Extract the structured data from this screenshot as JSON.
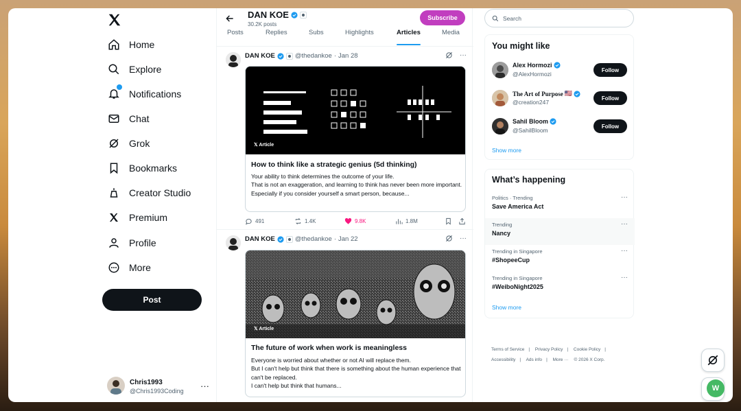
{
  "nav": {
    "items": [
      {
        "label": "Home",
        "icon": "home-icon"
      },
      {
        "label": "Explore",
        "icon": "search-icon"
      },
      {
        "label": "Notifications",
        "icon": "bell-icon"
      },
      {
        "label": "Chat",
        "icon": "mail-icon"
      },
      {
        "label": "Grok",
        "icon": "grok-icon"
      },
      {
        "label": "Bookmarks",
        "icon": "bookmark-icon"
      },
      {
        "label": "Creator Studio",
        "icon": "creator-studio-icon"
      },
      {
        "label": "Premium",
        "icon": "x-icon"
      },
      {
        "label": "Profile",
        "icon": "person-icon"
      },
      {
        "label": "More",
        "icon": "more-circle-icon"
      }
    ],
    "post_label": "Post",
    "account": {
      "name": "Chris1993",
      "handle": "@Chris1993Coding"
    }
  },
  "profile": {
    "name": "DAN KOE",
    "posts": "30.2K posts",
    "subscribe_label": "Subscribe",
    "tabs": [
      "Posts",
      "Replies",
      "Subs",
      "Highlights",
      "Articles",
      "Media"
    ],
    "active_tab": "Articles"
  },
  "tweets": [
    {
      "name": "DAN KOE",
      "handle": "@thedankoe",
      "date": "Jan 28",
      "article_tag": "Article",
      "title": "How to think like a strategic genius (5d thinking)",
      "body": [
        "Your ability to think determines the outcome of your life.",
        "That is not an exaggeration, and learning to think has never been more important.",
        "Especially if you consider yourself a smart person, because..."
      ],
      "replies": "491",
      "reposts": "1.4K",
      "likes": "9.8K",
      "views": "1.8M"
    },
    {
      "name": "DAN KOE",
      "handle": "@thedankoe",
      "date": "Jan 22",
      "article_tag": "Article",
      "title": "The future of work when work is meaningless",
      "body": [
        "Everyone is worried about whether or not AI will replace them.",
        "But I can't help but think that there is something about the human experience that can't be replaced.",
        "I can't help but think that humans..."
      ]
    }
  ],
  "search": {
    "placeholder": "Search"
  },
  "who_to_follow": {
    "title": "You might like",
    "users": [
      {
        "name": "Alex Hormozi",
        "handle": "@AlexHormozi",
        "follow_label": "Follow"
      },
      {
        "name": "The Art of Purpose",
        "flag": "🇺🇸",
        "handle": "@creation247",
        "follow_label": "Follow"
      },
      {
        "name": "Sahil Bloom",
        "handle": "@SahilBloom",
        "follow_label": "Follow"
      }
    ],
    "show_more": "Show more"
  },
  "happening": {
    "title": "What’s happening",
    "trends": [
      {
        "context": "Politics · Trending",
        "topic": "Save America Act"
      },
      {
        "context": "Trending",
        "topic": "Nancy"
      },
      {
        "context": "Trending in Singapore",
        "topic": "#ShopeeCup"
      },
      {
        "context": "Trending in Singapore",
        "topic": "#WeiboNight2025"
      }
    ],
    "show_more": "Show more"
  },
  "footer": {
    "links": [
      "Terms of Service",
      "Privacy Policy",
      "Cookie Policy",
      "Accessibility",
      "Ads info",
      "More ···"
    ],
    "copyright": "© 2026 X Corp."
  },
  "colors": {
    "accent": "#1d9bf0",
    "subscribe": "#c13ebf",
    "like": "#f91880"
  },
  "floating_badge": "W"
}
